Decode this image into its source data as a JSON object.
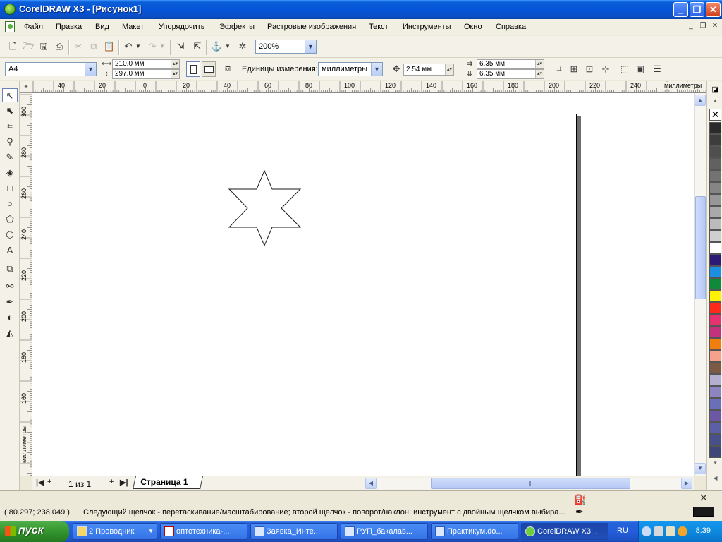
{
  "window": {
    "title": "CorelDRAW X3 - [Рисунок1]"
  },
  "menu": [
    "Файл",
    "Правка",
    "Вид",
    "Макет",
    "Упорядочить",
    "Эффекты",
    "Растровые изображения",
    "Текст",
    "Инструменты",
    "Окно",
    "Справка"
  ],
  "standard_toolbar": {
    "zoom": "200%"
  },
  "property_bar": {
    "paper_size": "A4",
    "width": "210.0 мм",
    "height": "297.0 мм",
    "units_label": "Единицы измерения:",
    "units": "миллиметры",
    "nudge": "2.54 мм",
    "dup_x": "6.35 мм",
    "dup_y": "6.35 мм"
  },
  "rulers": {
    "unit": "миллиметры",
    "horizontal_labels": [
      "40",
      "20",
      "0",
      "20",
      "40",
      "60",
      "80",
      "100",
      "120",
      "140",
      "160",
      "180",
      "200",
      "220",
      "240"
    ],
    "vertical_labels": [
      "300",
      "280",
      "260",
      "240",
      "220",
      "200",
      "180",
      "160",
      "140"
    ]
  },
  "page_nav": {
    "count": "1 из 1",
    "tab": "Страница 1"
  },
  "status": {
    "coords": "( 80.297; 238.049 )",
    "hint": "Следующий щелчок - перетаскивание/масштабирование; второй щелчок - поворот/наклон; инструмент с двойным щелчком выбира..."
  },
  "palette": [
    "#2b2b2b",
    "#3d3d3d",
    "#4f4f4f",
    "#616161",
    "#737373",
    "#858585",
    "#979797",
    "#a9a9a9",
    "#bbbbbb",
    "#cfcfcf",
    "#ffffff",
    "#2c1a75",
    "#1b8fe0",
    "#0f8a3b",
    "#fff200",
    "#ff2a1a",
    "#e8316f",
    "#c4317d",
    "#f07f10",
    "#f4a28c",
    "#7a5a45",
    "#b4aed1",
    "#8c85c0",
    "#6a70b8",
    "#6d59a3",
    "#5b5fa6",
    "#48508a",
    "#3d4579"
  ],
  "taskbar": {
    "start": "пуск",
    "tasks": [
      "2 Проводник",
      "оптотехника-...",
      "Заявка_Инте...",
      "РУП_бакалав...",
      "Практикум.do...",
      "CorelDRAW X3..."
    ],
    "lang": "RU",
    "time": "8:39"
  }
}
